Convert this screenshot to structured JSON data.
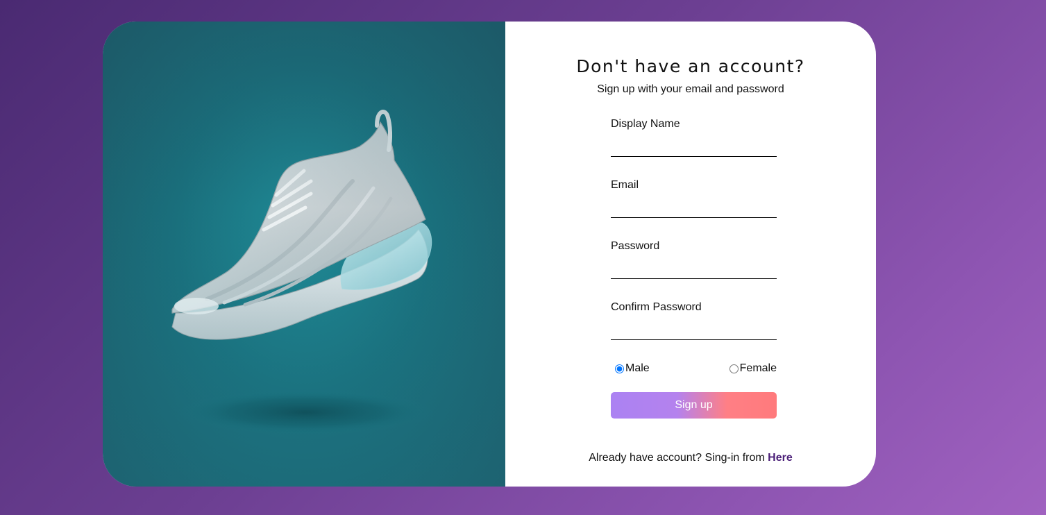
{
  "form": {
    "title": "Don't have an account?",
    "subtitle": "Sign up with your email and password",
    "fields": [
      {
        "label": "Display Name",
        "value": ""
      },
      {
        "label": "Email",
        "value": ""
      },
      {
        "label": "Password",
        "value": ""
      },
      {
        "label": "Confirm Password",
        "value": ""
      }
    ],
    "gender": {
      "male_label": "Male",
      "female_label": "Female",
      "selected": "Male"
    },
    "signup_label": "Sign up",
    "signin_text": "Already have account? Sing-in from",
    "signin_link": "Here"
  },
  "colors": {
    "hero_teal": "#1f8a96",
    "button_start": "#ab82f2",
    "button_end": "#ff7a7c",
    "link": "#4b1f78",
    "background_start": "#4a2a72",
    "background_end": "#a062c0"
  },
  "icons": {
    "hero_image": "sneaker-photo"
  }
}
